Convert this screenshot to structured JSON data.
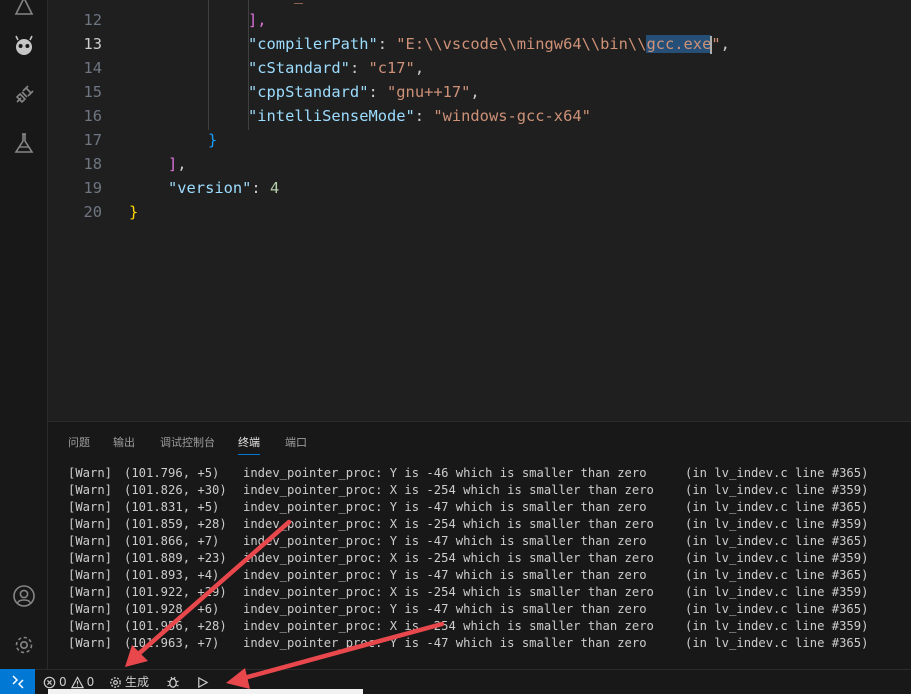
{
  "editor": {
    "lines": [
      {
        "num": "12",
        "indent": 200,
        "tokens": [
          {
            "t": "],",
            "c": "br2"
          }
        ]
      },
      {
        "num": "13",
        "indent": 200,
        "active": true,
        "tokens": [
          {
            "t": "\"compilerPath\"",
            "c": "key"
          },
          {
            "t": ": ",
            "c": "pun"
          },
          {
            "t": "\"E:\\\\vscode\\\\mingw64\\\\bin\\\\",
            "c": "str"
          },
          {
            "t": "gcc.ex",
            "c": "str sel"
          },
          {
            "t": "e",
            "c": "str sel cur"
          },
          {
            "t": "\"",
            "c": "str"
          },
          {
            "t": ",",
            "c": "pun"
          }
        ]
      },
      {
        "num": "14",
        "indent": 200,
        "tokens": [
          {
            "t": "\"cStandard\"",
            "c": "key"
          },
          {
            "t": ": ",
            "c": "pun"
          },
          {
            "t": "\"c17\"",
            "c": "str"
          },
          {
            "t": ",",
            "c": "pun"
          }
        ]
      },
      {
        "num": "15",
        "indent": 200,
        "tokens": [
          {
            "t": "\"cppStandard\"",
            "c": "key"
          },
          {
            "t": ": ",
            "c": "pun"
          },
          {
            "t": "\"gnu++17\"",
            "c": "str"
          },
          {
            "t": ",",
            "c": "pun"
          }
        ]
      },
      {
        "num": "16",
        "indent": 200,
        "tokens": [
          {
            "t": "\"intelliSenseMode\"",
            "c": "key"
          },
          {
            "t": ": ",
            "c": "pun"
          },
          {
            "t": "\"windows-gcc-x64\"",
            "c": "str"
          }
        ]
      },
      {
        "num": "17",
        "indent": 160,
        "tokens": [
          {
            "t": "}",
            "c": "br3"
          }
        ]
      },
      {
        "num": "18",
        "indent": 120,
        "tokens": [
          {
            "t": "]",
            "c": "br2"
          },
          {
            "t": ",",
            "c": "pun"
          }
        ]
      },
      {
        "num": "19",
        "indent": 120,
        "tokens": [
          {
            "t": "\"version\"",
            "c": "key"
          },
          {
            "t": ": ",
            "c": "pun"
          },
          {
            "t": "4",
            "c": "num"
          }
        ]
      },
      {
        "num": "20",
        "indent": 81,
        "tokens": [
          {
            "t": "}",
            "c": "br1"
          }
        ]
      }
    ]
  },
  "panel": {
    "tabs": [
      {
        "label": "问题"
      },
      {
        "label": "输出"
      },
      {
        "label": "调试控制台"
      },
      {
        "label": "终端",
        "active": true
      },
      {
        "label": "端口"
      }
    ],
    "terminal": [
      {
        "tag": "[Warn]",
        "time": "(101.796, +5)",
        "msg": "indev_pointer_proc: Y is -46 which is smaller than zero",
        "loc": "(in lv_indev.c line #365)"
      },
      {
        "tag": "[Warn]",
        "time": "(101.826, +30)",
        "msg": "indev_pointer_proc: X is -254 which is smaller than zero",
        "loc": "(in lv_indev.c line #359)"
      },
      {
        "tag": "[Warn]",
        "time": "(101.831, +5)",
        "msg": "indev_pointer_proc: Y is -47 which is smaller than zero",
        "loc": "(in lv_indev.c line #365)"
      },
      {
        "tag": "[Warn]",
        "time": "(101.859, +28)",
        "msg": "indev_pointer_proc: X is -254 which is smaller than zero",
        "loc": "(in lv_indev.c line #359)"
      },
      {
        "tag": "[Warn]",
        "time": "(101.866, +7)",
        "msg": "indev_pointer_proc: Y is -47 which is smaller than zero",
        "loc": "(in lv_indev.c line #365)"
      },
      {
        "tag": "[Warn]",
        "time": "(101.889, +23)",
        "msg": "indev_pointer_proc: X is -254 which is smaller than zero",
        "loc": "(in lv_indev.c line #359)"
      },
      {
        "tag": "[Warn]",
        "time": "(101.893, +4)",
        "msg": "indev_pointer_proc: Y is -47 which is smaller than zero",
        "loc": "(in lv_indev.c line #365)"
      },
      {
        "tag": "[Warn]",
        "time": "(101.922, +29)",
        "msg": "indev_pointer_proc: X is -254 which is smaller than zero",
        "loc": "(in lv_indev.c line #359)"
      },
      {
        "tag": "[Warn]",
        "time": "(101.928, +6)",
        "msg": "indev_pointer_proc: Y is -47 which is smaller than zero",
        "loc": "(in lv_indev.c line #365)"
      },
      {
        "tag": "[Warn]",
        "time": "(101.956, +28)",
        "msg": "indev_pointer_proc: X is -254 which is smaller than zero",
        "loc": "(in lv_indev.c line #359)"
      },
      {
        "tag": "[Warn]",
        "time": "(101.963, +7)",
        "msg": "indev_pointer_proc: Y is -47 which is smaller than zero",
        "loc": "(in lv_indev.c line #365)"
      }
    ]
  },
  "status": {
    "errors": "0",
    "warnings": "0",
    "build_label": "生成"
  },
  "colors": {
    "accent": "#0078d4",
    "annotation_arrow": "#e8474c"
  },
  "icons": {
    "activity": [
      "accounts-icon",
      "manage-gear-icon"
    ],
    "status": [
      "remote-icon",
      "error-icon",
      "warning-icon",
      "gear-icon",
      "bug-icon",
      "play-icon"
    ]
  }
}
